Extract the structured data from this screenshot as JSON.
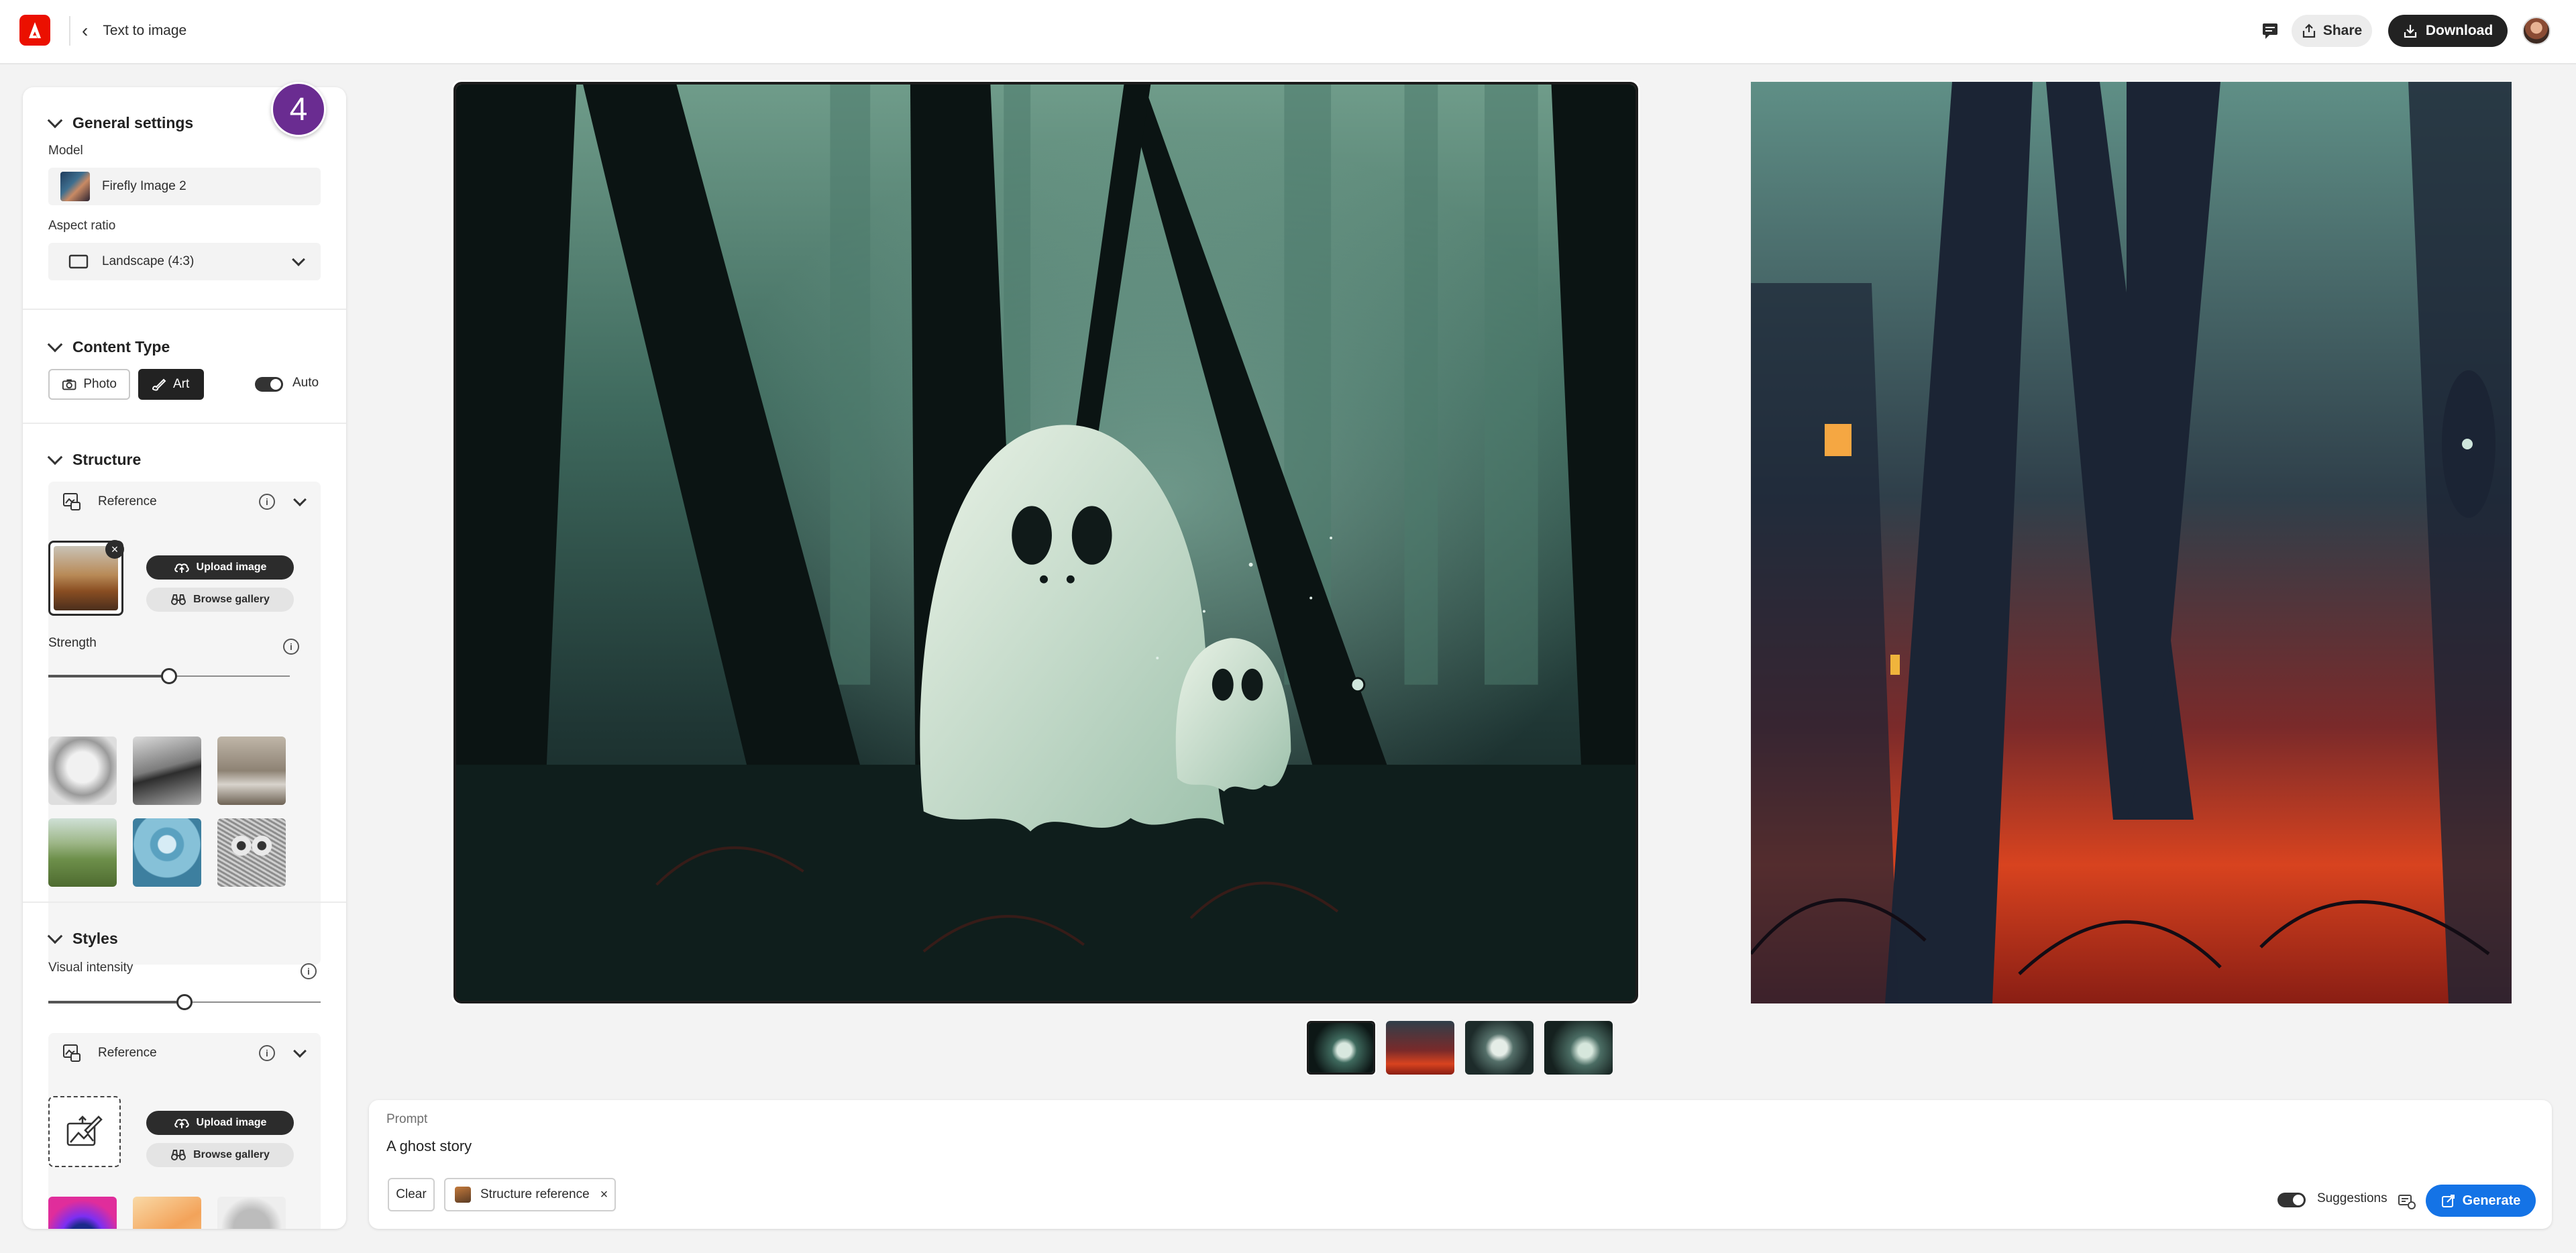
{
  "header": {
    "back_label": "Text to image",
    "share_label": "Share",
    "download_label": "Download"
  },
  "step_badge": "4",
  "general": {
    "title": "General settings",
    "model_label": "Model",
    "model_value": "Firefly Image 2",
    "aspect_label": "Aspect ratio",
    "aspect_value": "Landscape (4:3)"
  },
  "content_type": {
    "title": "Content Type",
    "photo_label": "Photo",
    "art_label": "Art",
    "selected": "Art",
    "auto_label": "Auto",
    "auto_on": true
  },
  "structure": {
    "title": "Structure",
    "reference_label": "Reference",
    "upload_label": "Upload image",
    "browse_label": "Browse gallery",
    "strength_label": "Strength",
    "strength_value": 0.5
  },
  "styles": {
    "title": "Styles",
    "intensity_label": "Visual intensity",
    "intensity_value": 0.5,
    "reference_label": "Reference",
    "upload_label": "Upload image",
    "browse_label": "Browse gallery"
  },
  "prompt": {
    "label": "Prompt",
    "text": "A ghost story",
    "clear_label": "Clear",
    "chip_label": "Structure reference",
    "suggestions_label": "Suggestions",
    "suggestions_on": true,
    "generate_label": "Generate"
  },
  "colors": {
    "brand_red": "#eb1000",
    "badge_purple": "#6a2c91",
    "generate_blue": "#1473e6"
  },
  "icons": [
    "adobe-logo",
    "chevron-left-icon",
    "feedback-icon",
    "share-icon",
    "download-icon",
    "camera-icon",
    "brush-icon",
    "reference-icon",
    "info-icon",
    "chevron-down-icon",
    "upload-icon",
    "binoculars-icon",
    "close-icon",
    "generate-icon"
  ]
}
